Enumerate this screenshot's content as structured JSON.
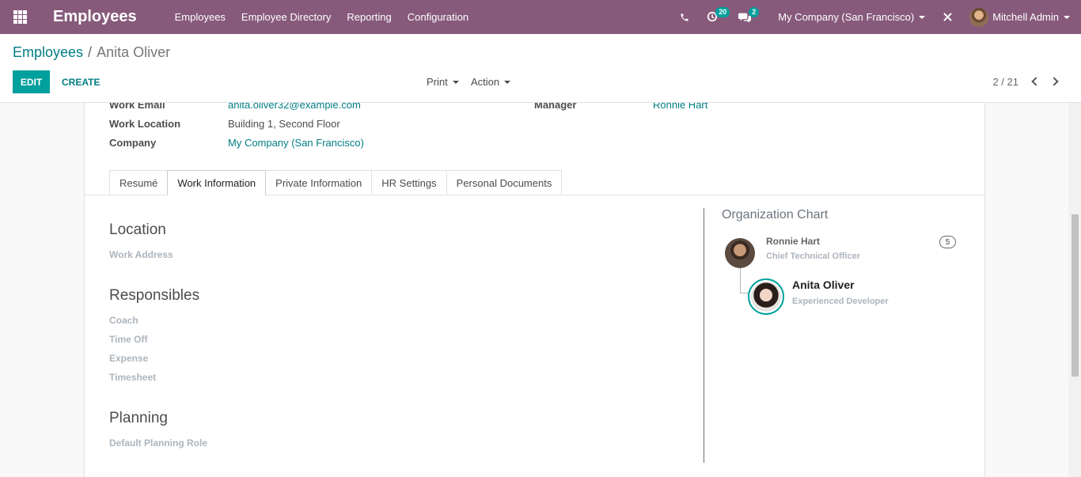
{
  "navbar": {
    "brand": "Employees",
    "menu": [
      "Employees",
      "Employee Directory",
      "Reporting",
      "Configuration"
    ],
    "activity_count": "20",
    "message_count": "2",
    "company": "My Company (San Francisco)",
    "user": "Mitchell Admin",
    "bg_color": "#875a7b"
  },
  "breadcrumb": {
    "parent": "Employees",
    "separator": "/",
    "current": "Anita Oliver"
  },
  "actions": {
    "edit": "EDIT",
    "create": "CREATE",
    "print": "Print",
    "action": "Action"
  },
  "pager": {
    "value": "2 / 21"
  },
  "fields": {
    "work_email_label": "Work Email",
    "work_email": "anita.oliver32@example.com",
    "work_location_label": "Work Location",
    "work_location": "Building 1, Second Floor",
    "company_label": "Company",
    "company": "My Company (San Francisco)",
    "manager_label": "Manager",
    "manager": "Ronnie Hart"
  },
  "tabs": [
    "Resumé",
    "Work Information",
    "Private Information",
    "HR Settings",
    "Personal Documents"
  ],
  "work_info": {
    "location_title": "Location",
    "work_address": "Work Address",
    "responsibles_title": "Responsibles",
    "coach": "Coach",
    "time_off": "Time Off",
    "expense": "Expense",
    "timesheet": "Timesheet",
    "planning_title": "Planning",
    "default_planning_role": "Default Planning Role"
  },
  "org_chart": {
    "title": "Organization Chart",
    "manager": {
      "name": "Ronnie Hart",
      "job": "Chief Technical Officer",
      "count": "5"
    },
    "self": {
      "name": "Anita Oliver",
      "job": "Experienced Developer"
    }
  }
}
